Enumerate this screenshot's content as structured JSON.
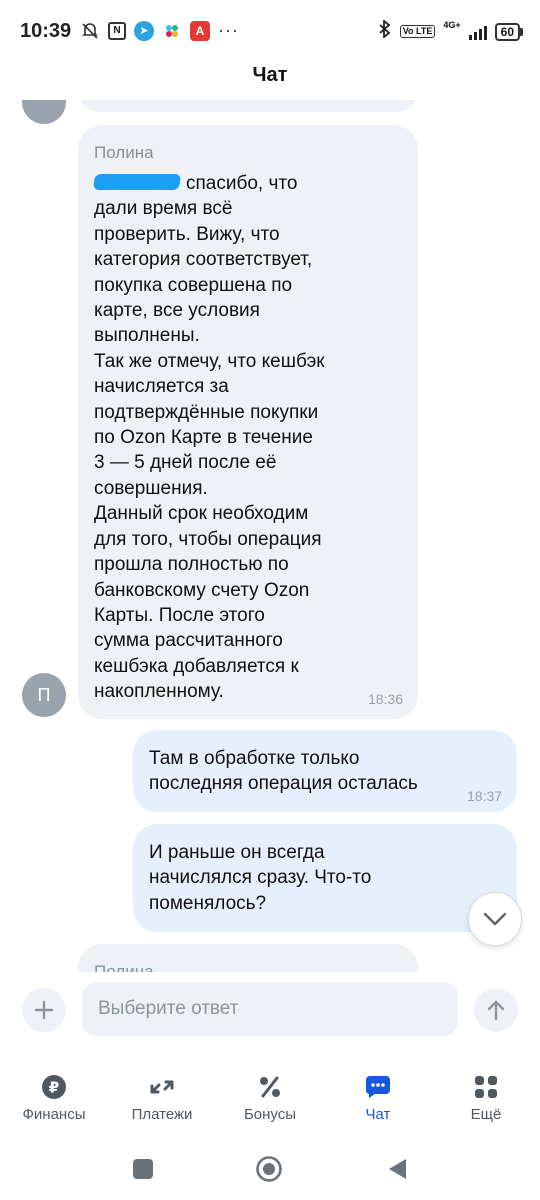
{
  "status_bar": {
    "time": "10:39",
    "battery": "60",
    "network": "4G+",
    "volte": "Vo LTE",
    "more": "···",
    "icons_left": [
      "mute-icon",
      "nfc-icon",
      "telegram-icon",
      "slack-icon",
      "avito-icon"
    ],
    "icons_right": [
      "bluetooth-icon",
      "volte-icon",
      "signal-icon",
      "battery-icon"
    ]
  },
  "header": {
    "title": "Чат"
  },
  "colors": {
    "accent": "#1659e0",
    "incoming_bubble": "#eef2f7",
    "outgoing_bubble": "#e6f0fc",
    "avatar": "#9aa2ad",
    "redaction": "#1e9ef0"
  },
  "messages": [
    {
      "direction": "incoming",
      "sender": "Полина",
      "avatar_letter": "П",
      "text_after_redaction": "спасибо, что",
      "text": "дали время всё\nпроверить. Вижу, что\nкатегория соответствует,\nпокупка совершена по\nкарте, все условия\nвыполнены.\nТак же отмечу, что кешбэк\nначисляется за\nподтверждённые покупки\nпо Ozon Карте в течение\n3 — 5 дней после её\nсовершения.\nДанный срок необходим\nдля того, чтобы операция\nпрошла полностью по\nбанковскому счету Ozon\nКарты. После этого\nсумма рассчитанного\nкешбэка добавляется к\nнакопленному.",
      "time": "18:36"
    },
    {
      "direction": "outgoing",
      "text": "Там в обработке только\nпоследняя операция осталась",
      "time": "18:37"
    },
    {
      "direction": "outgoing",
      "text": "И раньше он всегда\nначислялся сразу. Что-то\nпоменялось?",
      "time": ""
    },
    {
      "direction": "incoming",
      "sender": "Полина",
      "text": "",
      "time": ""
    }
  ],
  "composer": {
    "placeholder": "Выберите ответ",
    "add_icon": "plus-icon",
    "send_icon": "arrow-up-icon"
  },
  "bottom_nav": {
    "items": [
      {
        "label": "Финансы",
        "icon": "ruble-icon",
        "active": false
      },
      {
        "label": "Платежи",
        "icon": "transfer-arrows-icon",
        "active": false
      },
      {
        "label": "Бонусы",
        "icon": "percent-icon",
        "active": false
      },
      {
        "label": "Чат",
        "icon": "chat-icon",
        "active": true
      },
      {
        "label": "Ещё",
        "icon": "grid-icon",
        "active": false
      }
    ]
  },
  "system_nav": [
    "recents-icon",
    "home-icon",
    "back-icon"
  ]
}
